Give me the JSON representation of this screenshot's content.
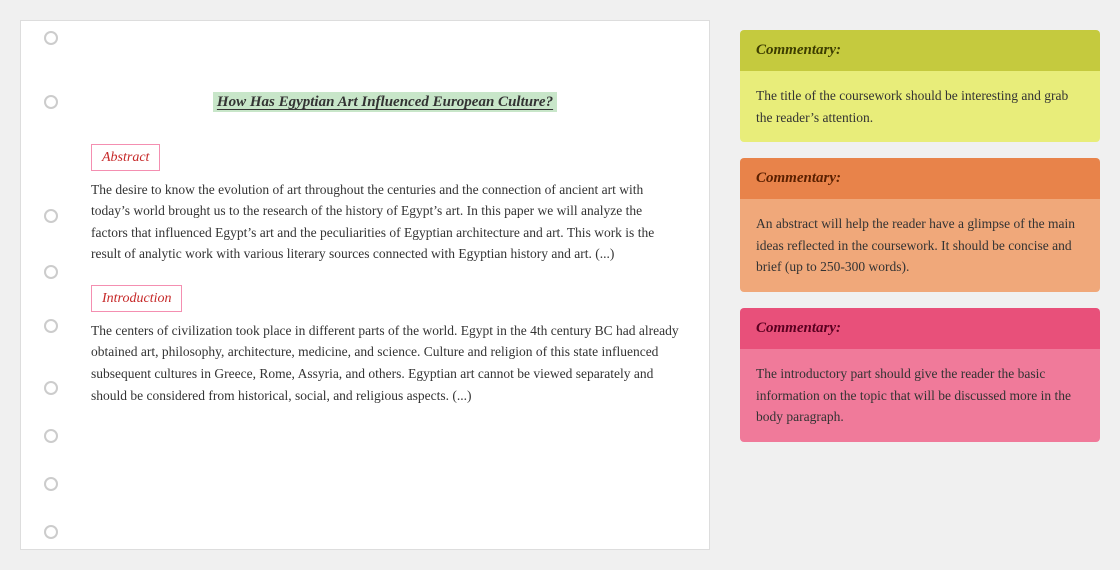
{
  "document": {
    "title": "How Has Egyptian Art Influenced European Culture?",
    "abstract_label": "Abstract",
    "abstract_text": "The desire to know the evolution of art throughout the centuries and the connection of ancient art with today’s world brought us to the research of the history of Egypt’s art. In this paper we will analyze the factors that influenced Egypt’s art and the peculiarities of Egyptian architecture and art. This work is the result of analytic work with various literary sources connected with Egyptian history and art. (...)",
    "introduction_label": "Introduction",
    "introduction_text": "The centers of civilization took place in different parts of the world. Egypt in the 4th century BC had already obtained art, philosophy, architecture, medicine, and science. Culture and religion of this state influenced subsequent cultures in Greece, Rome, Assyria, and others. Egyptian art cannot be viewed separately and should be considered from historical, social, and religious aspects. (...)"
  },
  "commentaries": [
    {
      "id": "commentary-title",
      "header": "Commentary:",
      "body": "The title of the coursework should be interesting and grab the reader’s attention.",
      "color": "green"
    },
    {
      "id": "commentary-abstract",
      "header": "Commentary:",
      "body": "An abstract will help the reader have a glimpse of the main ideas reflected in the coursework. It should be concise and brief (up to 250-300 words).",
      "color": "orange"
    },
    {
      "id": "commentary-introduction",
      "header": "Commentary:",
      "body": "The introductory part should give the reader the basic information on the topic that will be discussed more in the body paragraph.",
      "color": "pink"
    }
  ]
}
